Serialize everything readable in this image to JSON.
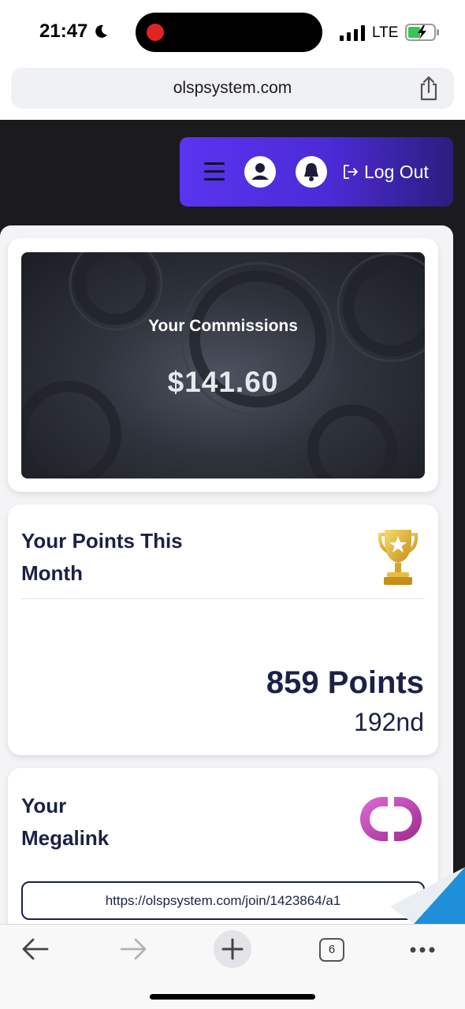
{
  "status_bar": {
    "time": "21:47",
    "network": "LTE"
  },
  "browser": {
    "url": "olspsystem.com",
    "tab_count": "6"
  },
  "nav": {
    "logout_label": "Log Out"
  },
  "commissions": {
    "title": "Your Commissions",
    "amount": "$141.60"
  },
  "points": {
    "title": "Your Points This Month",
    "value": "859 Points",
    "rank": "192nd"
  },
  "megalink": {
    "title_line1": "Your",
    "title_line2": "Megalink",
    "url": "https://olspsystem.com/join/1423864/a1"
  },
  "colors": {
    "nav_gradient_start": "#5a34f0",
    "nav_gradient_end": "#2c1d7e",
    "text_navy": "#1b2146",
    "page_dark": "#1b1b1d"
  },
  "icons": [
    "moon-icon",
    "record-indicator",
    "signal-icon",
    "battery-charging-icon",
    "share-icon",
    "hamburger-icon",
    "profile-icon",
    "bell-icon",
    "logout-icon",
    "trophy-icon",
    "megalink-icon",
    "back-arrow-icon",
    "forward-arrow-icon",
    "plus-icon",
    "tabs-icon",
    "more-icon"
  ]
}
